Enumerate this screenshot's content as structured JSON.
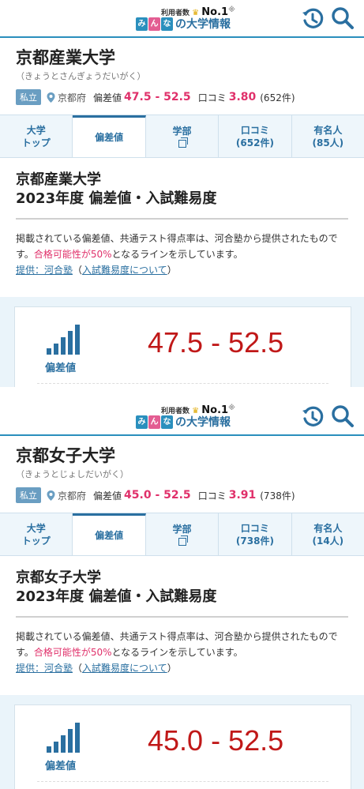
{
  "header": {
    "logo_top": "利用者数",
    "logo_no1": "No.1",
    "logo_mark": "※",
    "logo_boxes": [
      "み",
      "ん",
      "な"
    ],
    "logo_text": "の大学情報",
    "icons": [
      "history-icon",
      "search-icon"
    ]
  },
  "schools": [
    {
      "name": "京都産業大学",
      "reading": "（きょうとさんぎょうだいがく）",
      "type_badge": "私立",
      "prefecture": "京都府",
      "deviation_label": "偏差値",
      "deviation": "47.5 - 52.5",
      "review_label": "口コミ",
      "review_score": "3.80",
      "review_count": "(652件)",
      "tabs": [
        {
          "l1": "大学",
          "l2": "トップ"
        },
        {
          "l1": "偏差値",
          "l2": ""
        },
        {
          "l1": "学部",
          "l2": ""
        },
        {
          "l1": "口コミ",
          "l2": "(652件)"
        },
        {
          "l1": "有名人",
          "l2": "(85人)"
        }
      ],
      "section_line1": "京都産業大学",
      "section_line2": "2023年度 偏差値・入試難易度",
      "desc_a": "掲載されている偏差値、共通テスト得点率は、河合塾から提供されたものです。",
      "desc_pink": "合格可能性が50%",
      "desc_b": "となるラインを示しています。",
      "link_provider": "提供：河合塾",
      "link_about": "入試難易度について",
      "card_label": "偏差値",
      "card_value": "47.5 - 52.5"
    },
    {
      "name": "京都女子大学",
      "reading": "（きょうとじょしだいがく）",
      "type_badge": "私立",
      "prefecture": "京都府",
      "deviation_label": "偏差値",
      "deviation": "45.0 - 52.5",
      "review_label": "口コミ",
      "review_score": "3.91",
      "review_count": "(738件)",
      "tabs": [
        {
          "l1": "大学",
          "l2": "トップ"
        },
        {
          "l1": "偏差値",
          "l2": ""
        },
        {
          "l1": "学部",
          "l2": ""
        },
        {
          "l1": "口コミ",
          "l2": "(738件)"
        },
        {
          "l1": "有名人",
          "l2": "(14人)"
        }
      ],
      "section_line1": "京都女子大学",
      "section_line2": "2023年度 偏差値・入試難易度",
      "desc_a": "掲載されている偏差値、共通テスト得点率は、河合塾から提供されたものです。",
      "desc_pink": "合格可能性が50%",
      "desc_b": "となるラインを示しています。",
      "link_provider": "提供：河合塾",
      "link_about": "入試難易度について",
      "card_label": "偏差値",
      "card_value": "45.0 - 52.5"
    }
  ],
  "colors": {
    "brand_blue": "#2a6fa0",
    "accent_pink": "#e0306a",
    "value_red": "#c01818"
  }
}
